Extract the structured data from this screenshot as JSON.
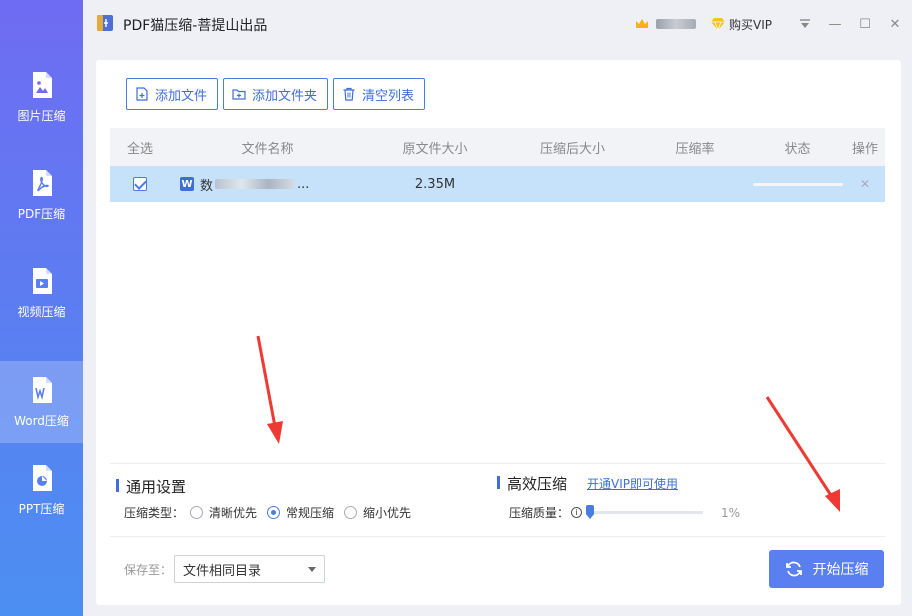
{
  "app": {
    "title": "PDF猫压缩-菩提山出品"
  },
  "titlebar": {
    "vip_label": "购买VIP",
    "minimize": "—",
    "maximize": "☐",
    "close": "✕"
  },
  "sidebar": {
    "items": [
      {
        "label": "图片压缩",
        "icon": "image-file-icon"
      },
      {
        "label": "PDF压缩",
        "icon": "pdf-file-icon"
      },
      {
        "label": "视频压缩",
        "icon": "video-file-icon"
      },
      {
        "label": "Word压缩",
        "icon": "word-file-icon",
        "active": true
      },
      {
        "label": "PPT压缩",
        "icon": "ppt-file-icon"
      }
    ]
  },
  "toolbar": {
    "add_file": "添加文件",
    "add_folder": "添加文件夹",
    "clear_list": "清空列表"
  },
  "table": {
    "headers": [
      "全选",
      "文件名称",
      "原文件大小",
      "压缩后大小",
      "压缩率",
      "状态",
      "操作"
    ],
    "rows": [
      {
        "name_prefix": "数",
        "name_suffix": "...",
        "orig_size": "2.35M",
        "comp_size": "",
        "ratio": "",
        "delete": "✕"
      }
    ]
  },
  "settings": {
    "general_title": "通用设置",
    "type_label": "压缩类型：",
    "options": [
      "清晰优先",
      "常规压缩",
      "缩小优先"
    ],
    "selected_option": 1,
    "efficient_title": "高效压缩",
    "vip_link": "开通VIP即可使用",
    "quality_label": "压缩质量：",
    "quality_value": "1%",
    "quality_fraction": 0.01
  },
  "footer": {
    "save_to_label": "保存至：",
    "save_to_value": "文件相同目录",
    "start_button": "开始压缩"
  },
  "colors": {
    "accent": "#4a7de0",
    "sidebar_top": "#6f6cf2",
    "sidebar_bottom": "#4c8ff2",
    "row_selected": "#c6e2fb",
    "arrow": "#ee3a32"
  }
}
